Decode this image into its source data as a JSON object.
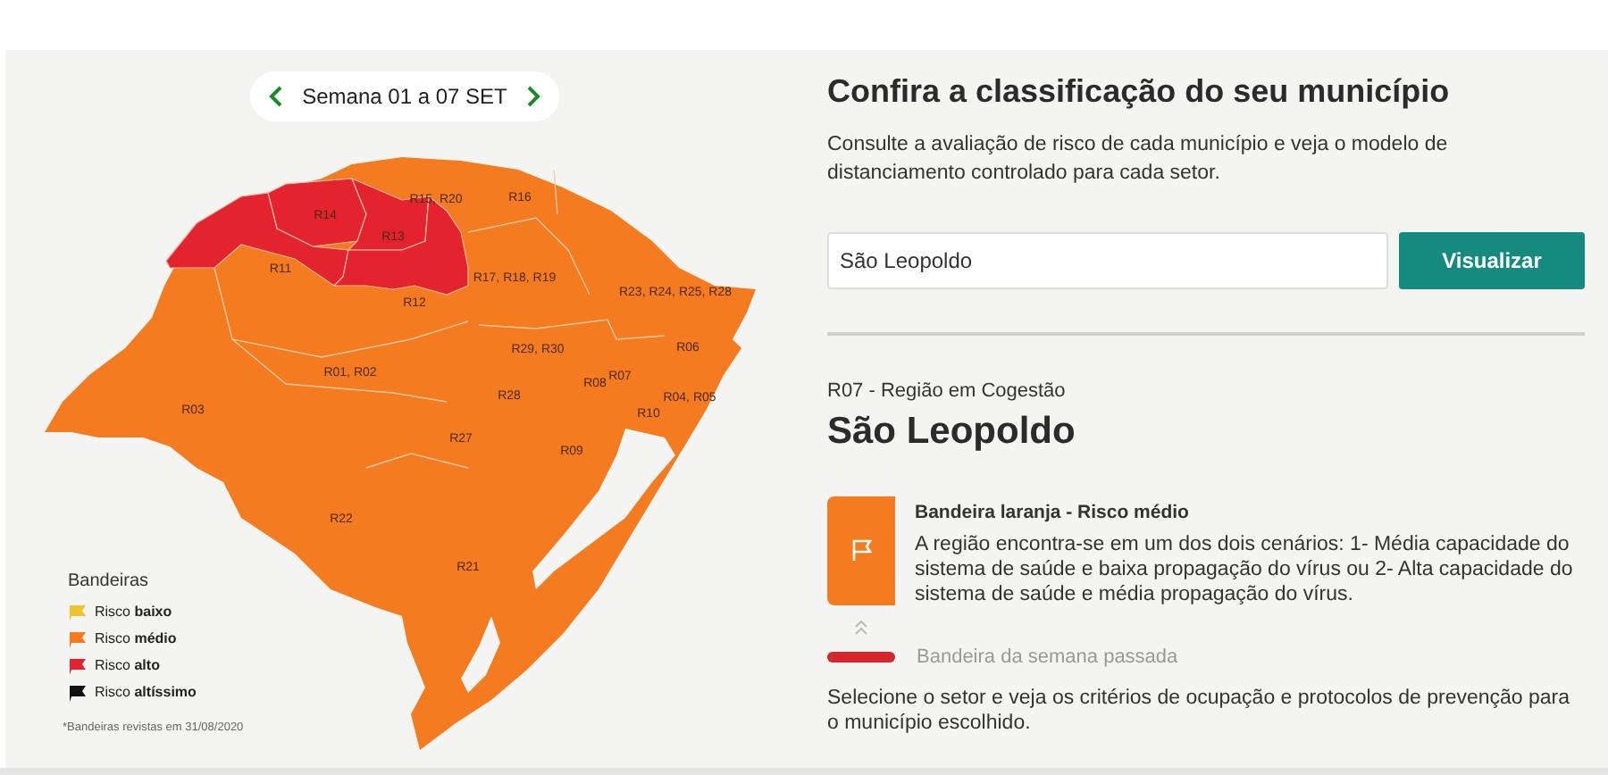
{
  "week_selector": {
    "label": "Semana 01 a 07 SET"
  },
  "map": {
    "regions": [
      {
        "label": "R14",
        "color": "#e3242f"
      },
      {
        "label": "R11",
        "color": "#e3242f"
      },
      {
        "label": "R13",
        "color": "#e3242f"
      },
      {
        "label": "R12",
        "color": "#e3242f"
      },
      {
        "label": "R15, R20"
      },
      {
        "label": "R16"
      },
      {
        "label": "R17, R18, R19"
      },
      {
        "label": "R23, R24, R25, R28"
      },
      {
        "label": "R06"
      },
      {
        "label": "R29, R30"
      },
      {
        "label": "R07"
      },
      {
        "label": "R08"
      },
      {
        "label": "R01, R02"
      },
      {
        "label": "R03"
      },
      {
        "label": "R28"
      },
      {
        "label": "R10"
      },
      {
        "label": "R04, R05"
      },
      {
        "label": "R27"
      },
      {
        "label": "R09"
      },
      {
        "label": "R22"
      },
      {
        "label": "R21"
      }
    ]
  },
  "legend": {
    "title": "Bandeiras",
    "items": [
      {
        "label": "Risco **baixo**",
        "color": "#f2c12e"
      },
      {
        "label": "Risco **médio**",
        "color": "#f47b20"
      },
      {
        "label": "Risco **alto**",
        "color": "#e3242f"
      },
      {
        "label": "Risco **altíssimo**",
        "color": "#111111"
      }
    ],
    "note": "*Bandeiras revistas em 31/08/2020"
  },
  "heading": "Confira a classificação do seu município",
  "description": "Consulte a avaliação de risco de cada município e veja o modelo de distanciamento controlado para cada setor.",
  "search": {
    "value": "São Leopoldo"
  },
  "button": "Visualizar",
  "result": {
    "region": "R07 - Região em Cogestão",
    "municipality": "São Leopoldo",
    "flag": {
      "title": "Bandeira laranja - Risco médio",
      "color": "#f47b20",
      "text": "A região encontra-se em um dos dois cenários: 1- Média capacidade do sistema de saúde e baixa propagação do vírus ou 2- Alta capacidade do sistema de saúde e média propagação do vírus."
    },
    "previous_flag": {
      "color": "#d32630",
      "label": "Bandeira da semana passada"
    },
    "instruction": "Selecione o setor e veja os critérios de ocupação e protocolos de prevenção para o município escolhido."
  }
}
